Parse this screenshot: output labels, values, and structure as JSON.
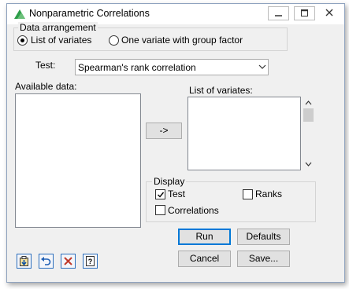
{
  "window": {
    "title": "Nonparametric Correlations"
  },
  "data_arrangement": {
    "legend": "Data arrangement",
    "options": [
      {
        "label": "List of variates",
        "selected": true
      },
      {
        "label": "One variate with group factor",
        "selected": false
      }
    ]
  },
  "test": {
    "label": "Test:",
    "value": "Spearman's rank correlation"
  },
  "available_data": {
    "label": "Available data:",
    "items": []
  },
  "move_button": {
    "label": "->"
  },
  "list_of_variates": {
    "label": "List of variates:",
    "items": []
  },
  "display": {
    "legend": "Display",
    "test_label": "Test",
    "test_checked": true,
    "ranks_label": "Ranks",
    "ranks_checked": false,
    "correlations_label": "Correlations",
    "correlations_checked": false
  },
  "buttons": {
    "run": "Run",
    "defaults": "Defaults",
    "cancel": "Cancel",
    "save": "Save..."
  },
  "toolbar_icons": [
    "clipboard-icon",
    "undo-icon",
    "clear-icon",
    "help-icon"
  ],
  "colors": {
    "accent": "#0078d7",
    "clear_red": "#c0392b",
    "app_icon_green": "#2e9e4a"
  }
}
